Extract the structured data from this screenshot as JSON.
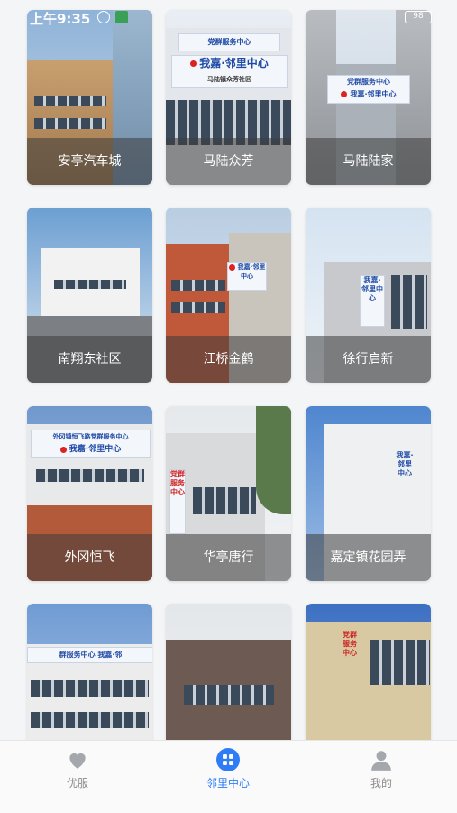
{
  "status": {
    "time": "上午9:35",
    "battery": "98"
  },
  "cards": [
    {
      "name": "安亭汽车城"
    },
    {
      "name": "马陆众芳",
      "sign_top": "党群服务中心",
      "sign_main": "我嘉·邻里中心",
      "sign_sub": "马陆镇众芳社区"
    },
    {
      "name": "马陆陆家",
      "sign_top": "党群服务中心",
      "sign_main": "我嘉·邻里中心"
    },
    {
      "name": "南翔东社区"
    },
    {
      "name": "江桥金鹤",
      "sign_main": "我嘉·邻里中心"
    },
    {
      "name": "徐行启新",
      "sign_main": "我嘉·邻里中心"
    },
    {
      "name": "外冈恒飞",
      "sign_top": "外冈镇恒飞路党群服务中心",
      "sign_main": "我嘉·邻里中心"
    },
    {
      "name": "华亭唐行",
      "sign_main": "党群服务中心"
    },
    {
      "name": "嘉定镇花园弄",
      "sign_main": "我嘉·邻里中心"
    },
    {
      "name": "",
      "sign_main": "群服务中心  我嘉·邻"
    },
    {
      "name": ""
    },
    {
      "name": "",
      "sign_main": "党群服务中心"
    }
  ],
  "tabbar": {
    "tabs": [
      {
        "label": "优服",
        "icon": "heart-icon",
        "active": false
      },
      {
        "label": "邻里中心",
        "icon": "grid-icon",
        "active": true
      },
      {
        "label": "我的",
        "icon": "user-icon",
        "active": false
      }
    ],
    "active_color": "#2f7df6",
    "inactive_color": "#8a8a8a"
  }
}
